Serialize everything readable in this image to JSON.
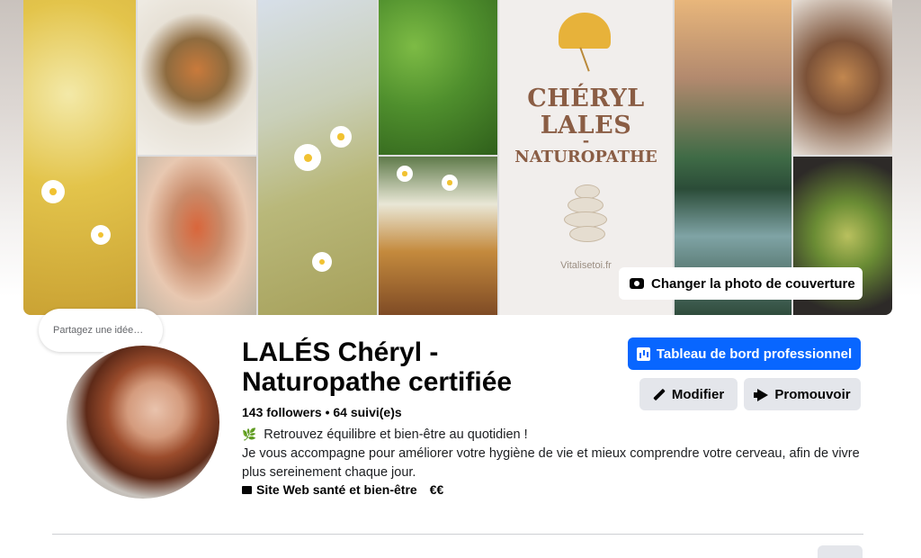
{
  "cover": {
    "brand_name_line1": "CHÉRYL",
    "brand_name_line2": "LALES",
    "brand_dash": "-",
    "brand_profession": "NATUROPATHE",
    "brand_site": "Vitalisetoi.fr",
    "change_cover_label": "Changer la photo de couverture"
  },
  "profile": {
    "thought_bubble": "Partagez une idée…",
    "name": "LALÉS Chéryl - Naturopathe certifiée",
    "stats": "143 followers • 64 suivi(e)s",
    "bio_line1": "Retrouvez équilibre et bien-être au quotidien !",
    "bio_line2": "Je vous accompagne pour améliorer votre hygiène de vie et mieux comprendre votre cerveau, afin de vivre plus sereinement chaque jour.",
    "category": "Site Web santé et bien-être",
    "price": "€€"
  },
  "actions": {
    "dashboard_label": "Tableau de bord professionnel",
    "edit_label": "Modifier",
    "promote_label": "Promouvoir"
  },
  "icons": {
    "camera": "camera-icon",
    "dashboard": "chart-icon",
    "edit": "pencil-icon",
    "promote": "megaphone-icon",
    "bio_leaf": "leaf-icon",
    "category": "folder-icon"
  },
  "colors": {
    "primary": "#0866ff",
    "secondary_button": "#e4e6eb",
    "text": "#050505",
    "brand_text": "#8a5d44"
  }
}
